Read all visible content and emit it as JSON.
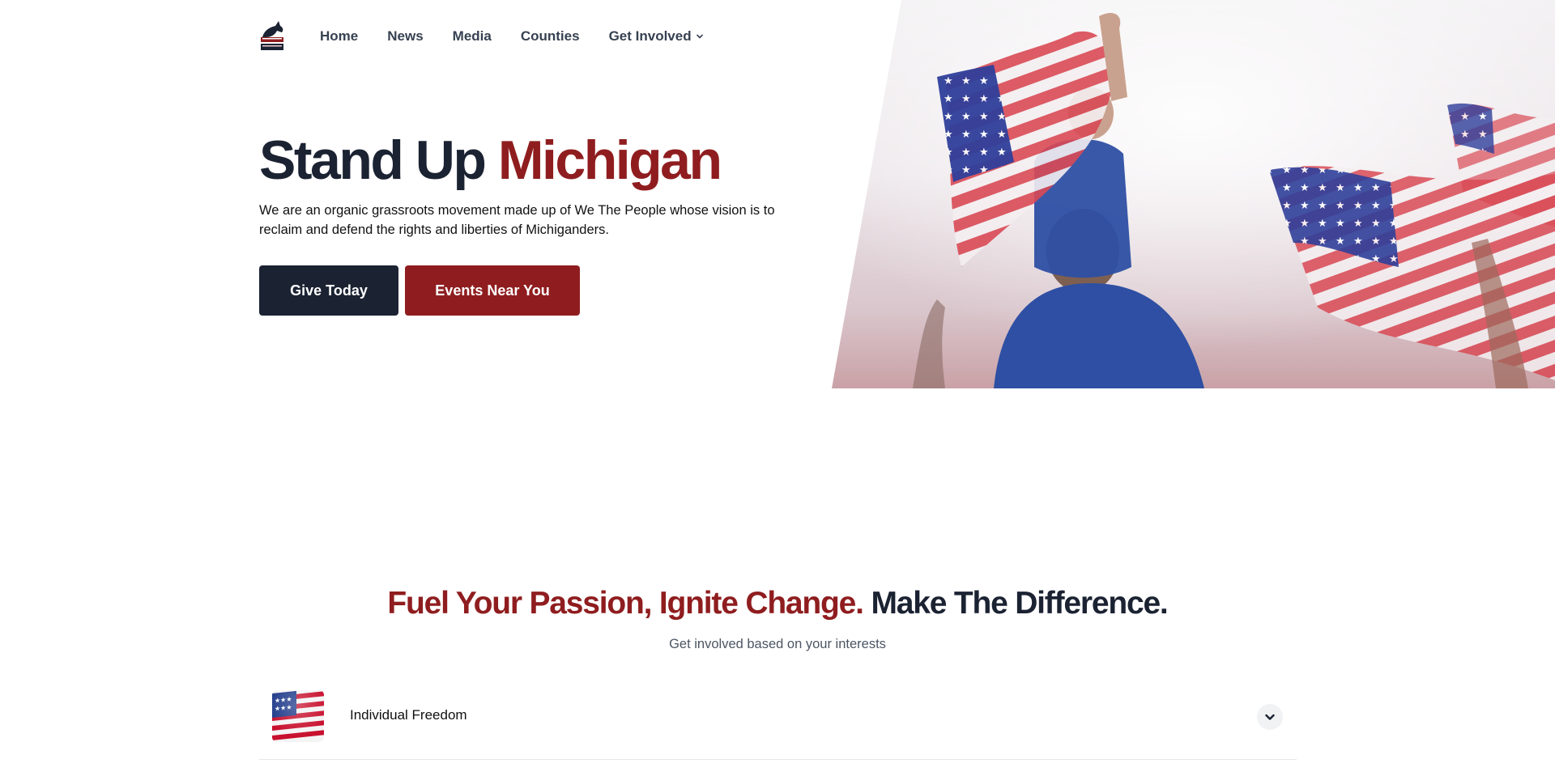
{
  "brand": {
    "logo_icon": "horse-logo-icon"
  },
  "nav": {
    "items": [
      {
        "label": "Home"
      },
      {
        "label": "News"
      },
      {
        "label": "Media"
      },
      {
        "label": "Counties"
      },
      {
        "label": "Get Involved",
        "icon": "chevron-down-icon"
      }
    ]
  },
  "hero": {
    "title_main": "Stand Up",
    "title_accent": "Michigan",
    "description": "We are an organic grassroots movement made up of We The People whose vision is to reclaim and defend the rights and liberties of Michiganders.",
    "buttons": {
      "give": "Give Today",
      "events": "Events Near You"
    }
  },
  "section": {
    "title_red": "Fuel Your Passion, Ignite Change.",
    "title_dark": "Make The Difference.",
    "subtitle": "Get involved based on your interests",
    "accordion": [
      {
        "label": "Individual Freedom",
        "icon": "us-flag-icon",
        "toggle_icon": "chevron-down-icon"
      }
    ]
  },
  "colors": {
    "primary_dark": "#1b2232",
    "accent_red": "#8f1d1f"
  }
}
